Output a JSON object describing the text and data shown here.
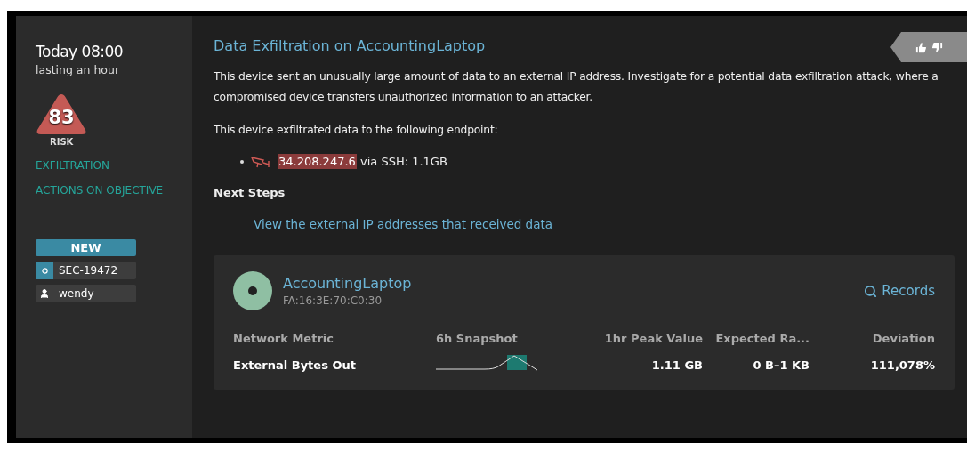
{
  "sidebar": {
    "time": "Today 08:00",
    "duration": "lasting an hour",
    "risk": {
      "score": "83",
      "label": "RISK"
    },
    "categories": [
      "EXFILTRATION",
      "ACTIONS ON OBJECTIVE"
    ],
    "status": "NEW",
    "ticket": "SEC-19472",
    "assignee": "wendy"
  },
  "detection": {
    "title": "Data Exfiltration on AccountingLaptop",
    "description": "This device sent an unusually large amount of data to an external IP address. Investigate for a potential data exfiltration attack, where a compromised device transfers unauthorized information to an attacker.",
    "endpoint_intro": "This device exfiltrated data to the following endpoint:",
    "endpoints": [
      {
        "ip": "34.208.247.6",
        "detail": "via SSH: 1.1GB"
      }
    ],
    "next_steps_title": "Next Steps",
    "next_steps": [
      "View the external IP addresses that received data"
    ]
  },
  "device": {
    "name": "AccountingLaptop",
    "mac": "FA:16:3E:70:C0:30",
    "records_link": "Records",
    "table": {
      "columns": [
        "Network Metric",
        "6h Snapshot",
        "1hr Peak Value",
        "Expected Ra...",
        "Deviation"
      ],
      "rows": [
        {
          "metric": "External Bytes Out",
          "peak": "1.11 GB",
          "expected": "0 B–1 KB",
          "deviation": "111,078%"
        }
      ]
    }
  }
}
